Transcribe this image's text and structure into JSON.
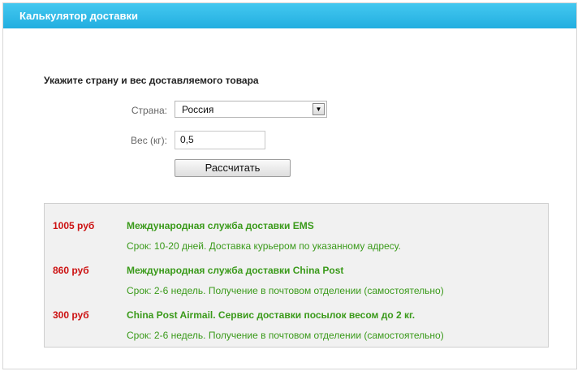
{
  "header": {
    "title": "Калькулятор доставки"
  },
  "form": {
    "instruction": "Укажите страну и вес доставляемого товара",
    "country_label": "Страна:",
    "country_value": "Россия",
    "weight_label": "Вес (кг):",
    "weight_value": "0,5",
    "submit_label": "Рассчитать"
  },
  "results": [
    {
      "price": "1005 руб",
      "name": "Международная служба доставки EMS",
      "description": "Срок: 10-20 дней. Доставка курьером по указанному адресу."
    },
    {
      "price": "860 руб",
      "name": "Международная служба доставки China Post",
      "description": "Срок: 2-6 недель. Получение в почтовом отделении (самостоятельно)"
    },
    {
      "price": "300 руб",
      "name": "China Post Airmail. Сервис доставки посылок весом до 2 кг.",
      "description": "Срок: 2-6 недель. Получение в почтовом отделении (самостоятельно)"
    }
  ],
  "colors": {
    "header": "#22aee0",
    "price": "#cc1111",
    "service": "#3a9a1a",
    "results_background": "#f1f1f1"
  }
}
